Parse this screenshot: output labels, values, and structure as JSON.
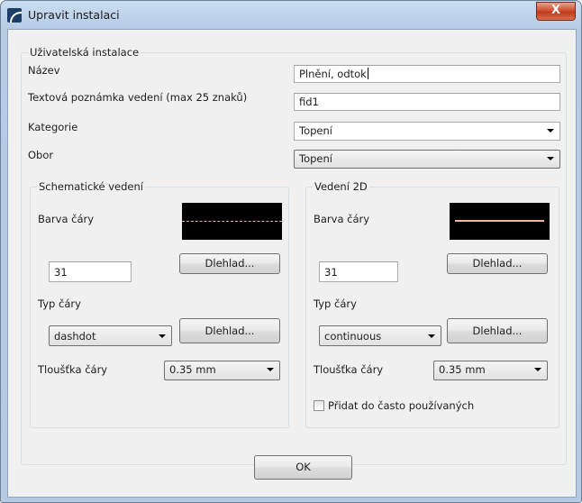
{
  "window": {
    "title": "Upravit instalaci",
    "close_label": "X"
  },
  "user_install": {
    "group_label": "Uživatelská instalace",
    "name_label": "Název",
    "name_value": "Plnění, odtok",
    "note_label": "Textová poznámka vedení (max 25 znaků)",
    "note_value": "fid1",
    "category_label": "Kategorie",
    "category_value": "Topení",
    "field_label": "Obor",
    "field_value": "Topení"
  },
  "schematic": {
    "group_label": "Schematické vedení",
    "color_label": "Barva čáry",
    "color_value": "31",
    "preview_button": "Dlehlad...",
    "line_type_label": "Typ čáry",
    "line_type_value": "dashdot",
    "line_type_preview_button": "Dlehlad...",
    "thickness_label": "Tloušťka čáry",
    "thickness_value": "0.35 mm"
  },
  "piping2d": {
    "group_label": "Vedení 2D",
    "color_label": "Barva čáry",
    "color_value": "31",
    "preview_button": "Dlehlad...",
    "line_type_label": "Typ čáry",
    "line_type_value": "continuous",
    "line_type_preview_button": "Dlehlad...",
    "thickness_label": "Tloušťka čáry",
    "thickness_value": "0.35 mm",
    "favorites_label": "Přidat do často používaných",
    "favorites_checked": false
  },
  "footer": {
    "ok_label": "OK"
  },
  "colors": {
    "swatch_bg": "#000000",
    "line_color": "#f2b89c",
    "close_red": "#c13a1b"
  }
}
